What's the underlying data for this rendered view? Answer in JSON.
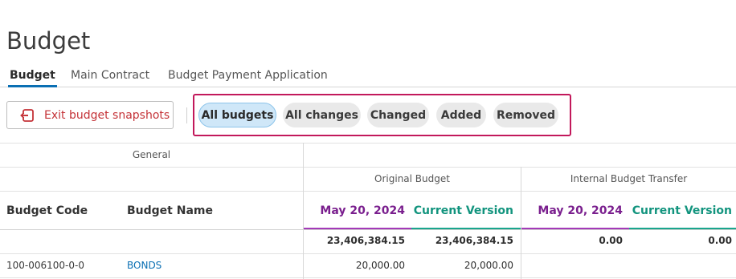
{
  "page": {
    "title": "Budget"
  },
  "tabs": [
    {
      "label": "Budget",
      "active": true
    },
    {
      "label": "Main Contract",
      "active": false
    },
    {
      "label": "Budget Payment Application",
      "active": false
    }
  ],
  "toolbar": {
    "exit_label": "Exit budget snapshots",
    "exit_icon": "exit-icon"
  },
  "filters": [
    {
      "label": "All budgets",
      "active": true
    },
    {
      "label": "All changes",
      "active": false
    },
    {
      "label": "Changed",
      "active": false
    },
    {
      "label": "Added",
      "active": false
    },
    {
      "label": "Removed",
      "active": false
    }
  ],
  "table": {
    "groups": {
      "general": "General",
      "original_budget": "Original Budget",
      "internal_transfer": "Internal Budget Transfer"
    },
    "columns": {
      "budget_code": "Budget Code",
      "budget_name": "Budget Name",
      "ob_date": "May 20, 2024",
      "ob_current": "Current Version",
      "ibt_date": "May 20, 2024",
      "ibt_current": "Current Version"
    },
    "totals": {
      "ob_date": "23,406,384.15",
      "ob_current": "23,406,384.15",
      "ibt_date": "0.00",
      "ibt_current": "0.00"
    },
    "rows": [
      {
        "code": "100-006100-0-0",
        "name": "BONDS",
        "ob_date": "20,000.00",
        "ob_current": "20,000.00"
      }
    ]
  },
  "colors": {
    "accent": "#0a6fb3",
    "snapshot_date": "#7a1f8e",
    "current_version": "#12947e",
    "exit_text": "#c43237",
    "highlight_box": "#c2185b"
  }
}
